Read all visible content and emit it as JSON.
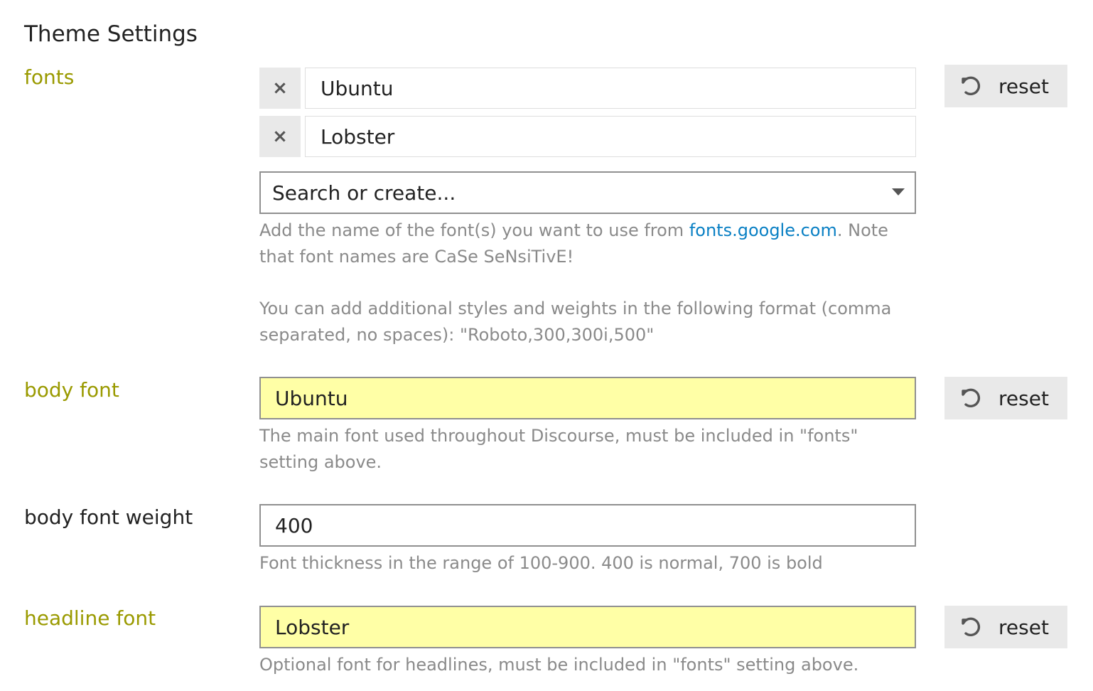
{
  "page": {
    "title": "Theme Settings"
  },
  "settings": {
    "fonts": {
      "label": "fonts",
      "chips": [
        {
          "value": "Ubuntu",
          "remove_glyph": "×"
        },
        {
          "value": "Lobster",
          "remove_glyph": "×"
        }
      ],
      "combo_placeholder": "Search or create...",
      "desc_before_link": "Add the name of the font(s) you want to use from ",
      "desc_link": "fonts.google.com",
      "desc_after_link": ". Note that font names are CaSe SeNsiTivE!",
      "desc_second": "You can add additional styles and weights in the following format (comma separated, no spaces): \"Roboto,300,300i,500\"",
      "reset_label": "reset"
    },
    "body_font": {
      "label": "body font",
      "value": "Ubuntu",
      "description": "The main font used throughout Discourse, must be included in \"fonts\" setting above.",
      "reset_label": "reset"
    },
    "body_font_weight": {
      "label": "body font weight",
      "value": "400",
      "description": "Font thickness in the range of 100-900. 400 is normal, 700 is bold"
    },
    "headline_font": {
      "label": "headline font",
      "value": "Lobster",
      "description": "Optional font for headlines, must be included in \"fonts\" setting above.",
      "reset_label": "reset"
    }
  },
  "colors": {
    "modified_label": "#9a9a00",
    "modified_input_bg": "#ffffa6",
    "link": "#0a80c4",
    "description_text": "#8a8a8a",
    "button_bg": "#e9e9e9"
  },
  "icons": {
    "reset": "undo-icon",
    "remove": "close-icon",
    "dropdown": "caret-down-icon"
  }
}
